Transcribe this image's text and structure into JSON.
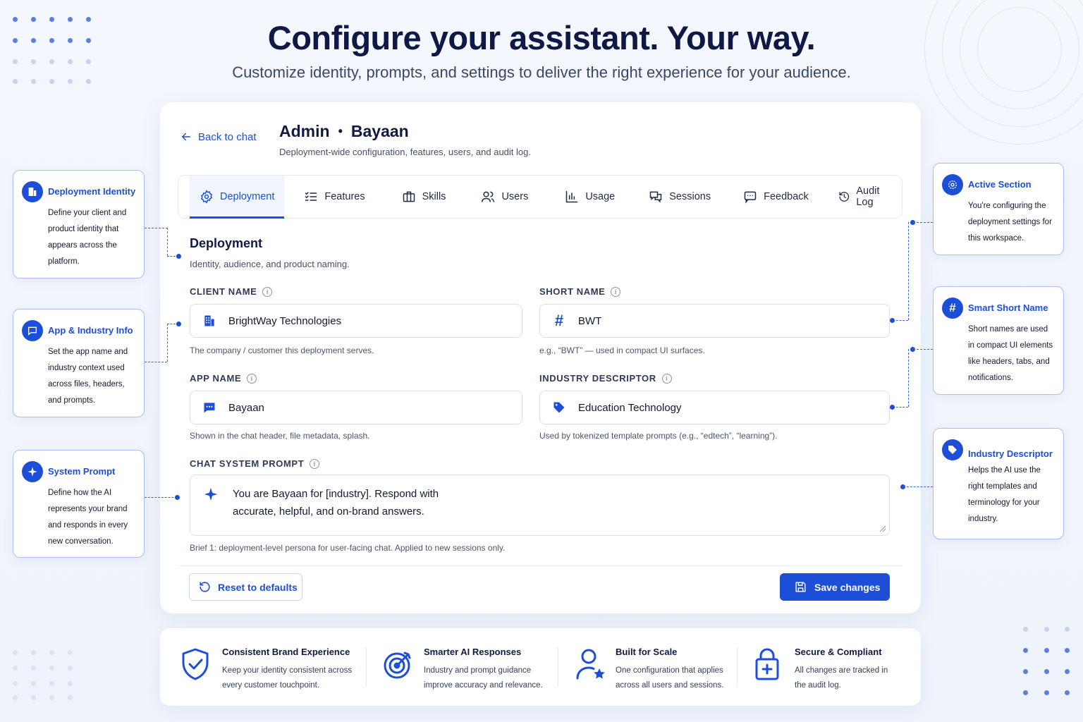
{
  "hero": {
    "title": "Configure your assistant. Your way.",
    "subtitle": "Customize identity, prompts, and settings to deliver the right experience for your audience."
  },
  "header": {
    "back_label": "Back to chat",
    "title_left": "Admin",
    "title_sep": "•",
    "title_right": "Bayaan",
    "subtitle": "Deployment-wide configuration, features, users, and audit log."
  },
  "tabs": [
    {
      "label": "Deployment",
      "icon": "gear-icon",
      "active": true
    },
    {
      "label": "Features",
      "icon": "checklist-icon"
    },
    {
      "label": "Skills",
      "icon": "briefcase-icon"
    },
    {
      "label": "Users",
      "icon": "users-icon"
    },
    {
      "label": "Usage",
      "icon": "bar-chart-icon"
    },
    {
      "label": "Sessions",
      "icon": "chat-bubbles-icon"
    },
    {
      "label": "Feedback",
      "icon": "feedback-icon"
    },
    {
      "label": "Audit Log",
      "icon": "history-icon"
    }
  ],
  "section": {
    "title": "Deployment",
    "subtitle": "Identity, audience, and product naming."
  },
  "fields": {
    "client_name": {
      "label": "CLIENT NAME",
      "value": "BrightWay Technologies",
      "helper": "The company / customer this deployment serves.",
      "icon": "building-icon"
    },
    "short_name": {
      "label": "SHORT NAME",
      "value": "BWT",
      "helper": "e.g., “BWT” — used in compact UI surfaces.",
      "icon": "hash-icon"
    },
    "app_name": {
      "label": "APP NAME",
      "value": "Bayaan",
      "helper": "Shown in the chat header, file metadata, splash.",
      "icon": "chat-icon"
    },
    "industry_descriptor": {
      "label": "INDUSTRY DESCRIPTOR",
      "value": "Education Technology",
      "helper": "Used by tokenized template prompts (e.g., “edtech”, “learning”).",
      "icon": "tag-icon"
    },
    "chat_system_prompt": {
      "label": "CHAT SYSTEM PROMPT",
      "value_line1": "You are Bayaan for [industry]. Respond with",
      "value_line2": "accurate, helpful, and on-brand answers.",
      "helper": "Brief 1: deployment-level persona for user-facing chat. Applied to new sessions only.",
      "icon": "sparkle-icon"
    }
  },
  "actions": {
    "reset_label": "Reset to defaults",
    "save_label": "Save changes"
  },
  "callouts_left": [
    {
      "title": "Deployment Identity",
      "body": "Define your client and product identity that appears across the platform.",
      "icon": "building-icon"
    },
    {
      "title": "App & Industry Info",
      "body": "Set the app name and industry context used across files, headers, and prompts.",
      "icon": "chat-icon"
    },
    {
      "title": "System Prompt",
      "body": "Define how the AI represents your brand and responds in every new conversation.",
      "icon": "sparkle-icon"
    }
  ],
  "callouts_right": [
    {
      "title": "Active Section",
      "body": "You're configuring the deployment settings for this workspace.",
      "icon": "gear-icon"
    },
    {
      "title": "Smart Short Name",
      "body": "Short names are used in compact UI elements like headers, tabs, and notifications.",
      "icon": "hash-icon"
    },
    {
      "title": "Industry Descriptor",
      "body": "Helps the AI use the right templates and terminology for your industry.",
      "icon": "tag-icon"
    }
  ],
  "features": [
    {
      "title": "Consistent Brand Experience",
      "body": "Keep your identity consistent across every customer touchpoint.",
      "icon": "shield-check-icon"
    },
    {
      "title": "Smarter AI Responses",
      "body": "Industry and prompt guidance improve accuracy and relevance.",
      "icon": "target-icon"
    },
    {
      "title": "Built for Scale",
      "body": "One configuration that applies across all users and sessions.",
      "icon": "user-star-icon"
    },
    {
      "title": "Secure & Compliant",
      "body": "All changes are tracked in the audit log.",
      "icon": "lock-plus-icon"
    }
  ],
  "colors": {
    "accent": "#1d4ed8",
    "title": "#0e1a45",
    "background": "#f4f7fd"
  }
}
